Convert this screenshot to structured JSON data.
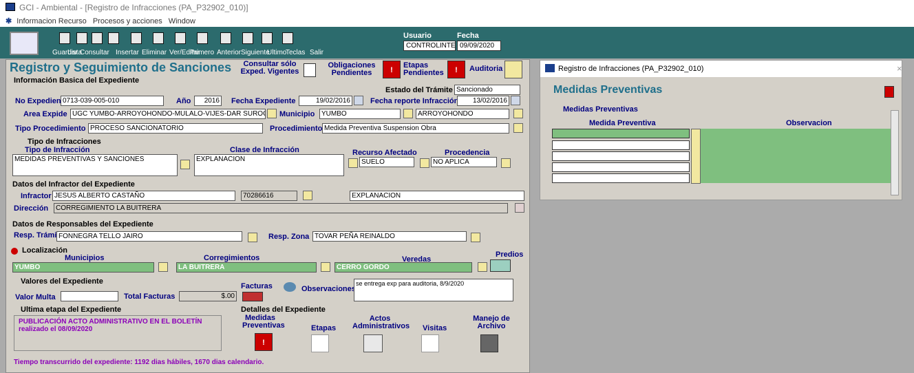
{
  "window": {
    "title": "GCI - Ambiental - [Registro de Infracciones (PA_P32902_010)]"
  },
  "menu": [
    "Informacion Recurso",
    "Procesos y acciones",
    "Window"
  ],
  "toolbar": {
    "buttons": [
      "Guardar",
      "Lista",
      "Consultar",
      "Insertar",
      "Eliminar",
      "Ver/Editar",
      "Primero",
      "Anterior",
      "Siguiente",
      "Ultimo",
      "Teclas",
      "Salir"
    ],
    "usuario_label": "Usuario",
    "usuario": "CONTROLINTE",
    "fecha_label": "Fecha",
    "fecha": "09/09/2020"
  },
  "form": {
    "title": "Registro y Seguimiento de Sanciones",
    "top_links": {
      "consultar": "Consultar sólo Exped. Vigentes",
      "obligaciones": "Obligaciones Pendientes",
      "etapas": "Etapas Pendientes",
      "auditoria": "Auditoria"
    },
    "info_section": "Información Basica del Expediente",
    "estado_label": "Estado del Trámite",
    "estado": "Sancionado",
    "no_exp_label": "No Expediente",
    "no_exp": "0713-039-005-010",
    "anio_label": "Año",
    "anio": "2016",
    "fecha_exp_label": "Fecha Expediente",
    "fecha_exp": "19/02/2016",
    "fecha_rep_label": "Fecha reporte Infracción",
    "fecha_rep": "13/02/2016",
    "area_label": "Area Expide",
    "area": "UGC YUMBO-ARROYOHONDO-MULALO-VIJES-DAR SUROCCI",
    "municipio_label": "Municipio",
    "municipio": "YUMBO",
    "municipio2": "ARROYOHONDO",
    "tipo_proc_label": "Tipo Procedimiento",
    "tipo_proc": "PROCESO SANCIONATORIO",
    "proc_label": "Procedimiento",
    "proc": "Medida Preventiva Suspension Obra",
    "tipos_inf_title": "Tipo de Infracciones",
    "tipo_inf_label": "Tipo de Infracción",
    "tipo_inf": "MEDIDAS PREVENTIVAS Y SANCIONES",
    "clase_label": "Clase de Infracción",
    "clase": "EXPLANACION",
    "recurso_label": "Recurso Afectado",
    "recurso": "SUELO",
    "procedencia_label": "Procedencia",
    "procedencia": "NO APLICA",
    "infractor_section": "Datos del Infractor del Expediente",
    "infractor_label": "Infractor",
    "infractor": "JESUS ALBERTO CASTAÑO",
    "infractor_id": "70286616",
    "infractor_desc": "EXPLANACION",
    "direccion_label": "Dirección",
    "direccion": "CORREGIMIENTO LA BUITRERA",
    "resp_section": "Datos de Responsables del Expediente",
    "resp_tramite_label": "Resp. Trámite",
    "resp_tramite": "FONNEGRA TELLO JAIRO",
    "resp_zona_label": "Resp. Zona",
    "resp_zona": "TOVAR PEÑA REINALDO",
    "loc_title": "Localización",
    "mun_label": "Municipios",
    "mun": "YUMBO",
    "corr_label": "Corregimientos",
    "corr": "LA BUITRERA",
    "ver_label": "Veredas",
    "ver": "CERRO GORDO",
    "predios_label": "Predios",
    "valores_title": "Valores del Expediente",
    "valor_multa_label": "Valor Multa",
    "valor_multa": "",
    "total_fact_label": "Total Facturas",
    "total_fact": "$.00",
    "facturas_label": "Facturas",
    "obs_label": "Observaciones",
    "obs": "se entrega exp para auditoria, 8/9/2020",
    "ultima_title": "Ultima etapa del Expediente",
    "ultima_text": "PUBLICACIÓN ACTO ADMINISTRATIVO EN EL BOLETÍN realizado el 08/09/2020",
    "detalles_title": "Detalles del Expediente",
    "det_medidas": "Medidas Preventivas",
    "det_etapas": "Etapas",
    "det_actos": "Actos Administrativos",
    "det_visitas": "Visitas",
    "det_manejo": "Manejo de Archivo",
    "footer": "Tiempo transcurrido del expediente: 1192 dias hábiles, 1670 dias calendario."
  },
  "popup": {
    "title": "Registro de Infracciones (PA_P32902_010)",
    "heading": "Medidas Preventivas",
    "section": "Medidas Preventivas",
    "col1": "Medida Preventiva",
    "col2": "Observacion"
  },
  "colors": {
    "toolbar": "#2c6b6d",
    "heading": "#1f6f8b",
    "label": "#000080",
    "green": "#7fbf7f"
  }
}
